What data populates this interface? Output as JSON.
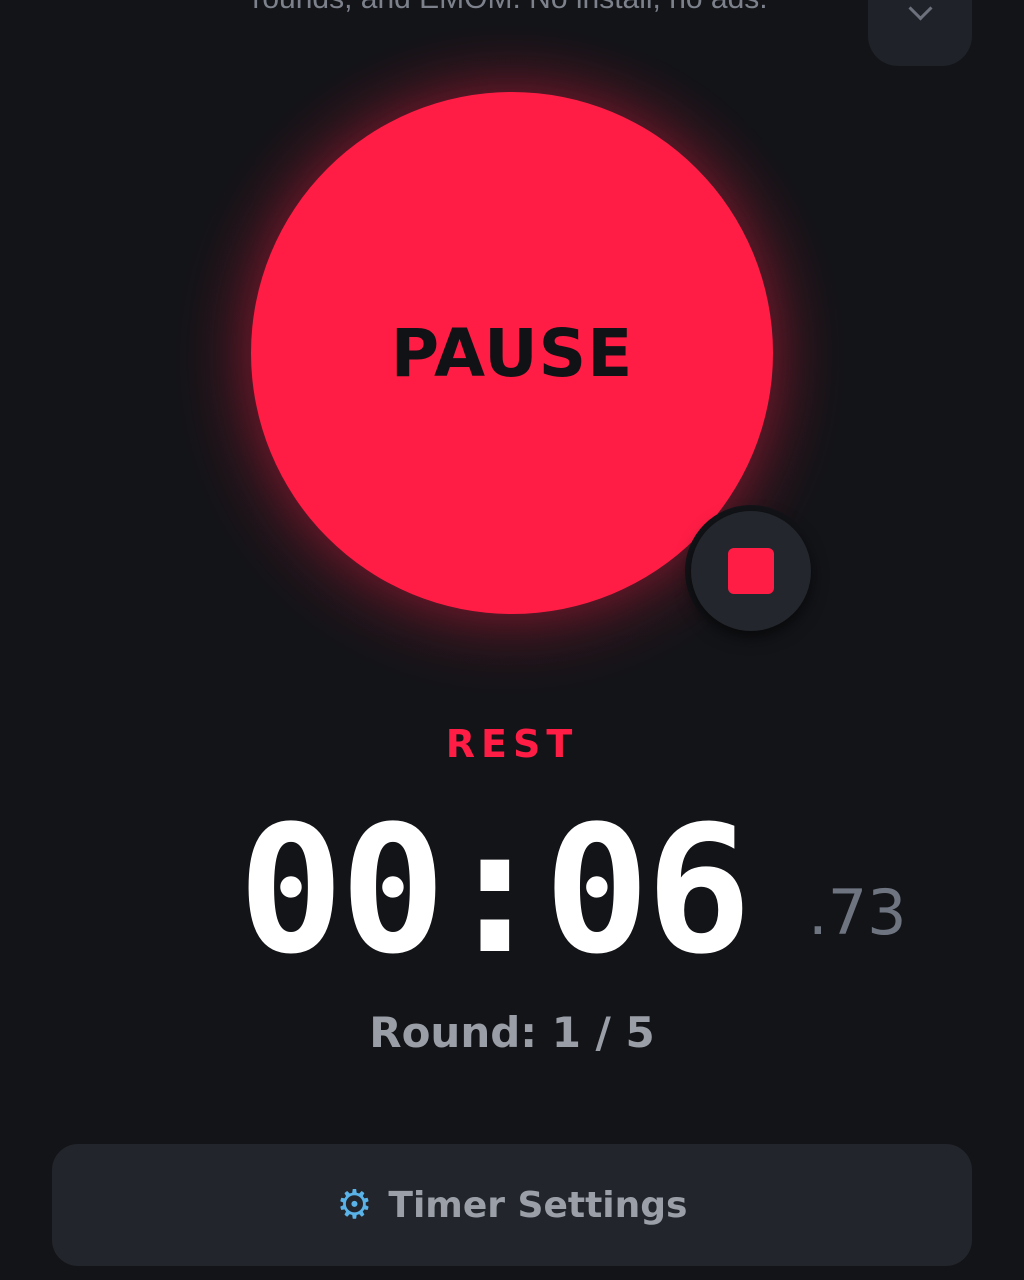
{
  "header": {
    "subtitle": "rounds, and EMOM. No install, no ads."
  },
  "controls": {
    "pause_label": "PAUSE",
    "stop_icon": "stop-icon"
  },
  "timer": {
    "phase": "REST",
    "time": "00:06",
    "fraction": ".73",
    "round": "Round: 1 / 5"
  },
  "footer": {
    "settings_icon": "gear-icon",
    "settings_label": "Timer Settings"
  },
  "colors": {
    "background": "#131418",
    "accent": "#ff1d45",
    "panel": "#22252b",
    "muted_text": "#9a9ea6"
  }
}
